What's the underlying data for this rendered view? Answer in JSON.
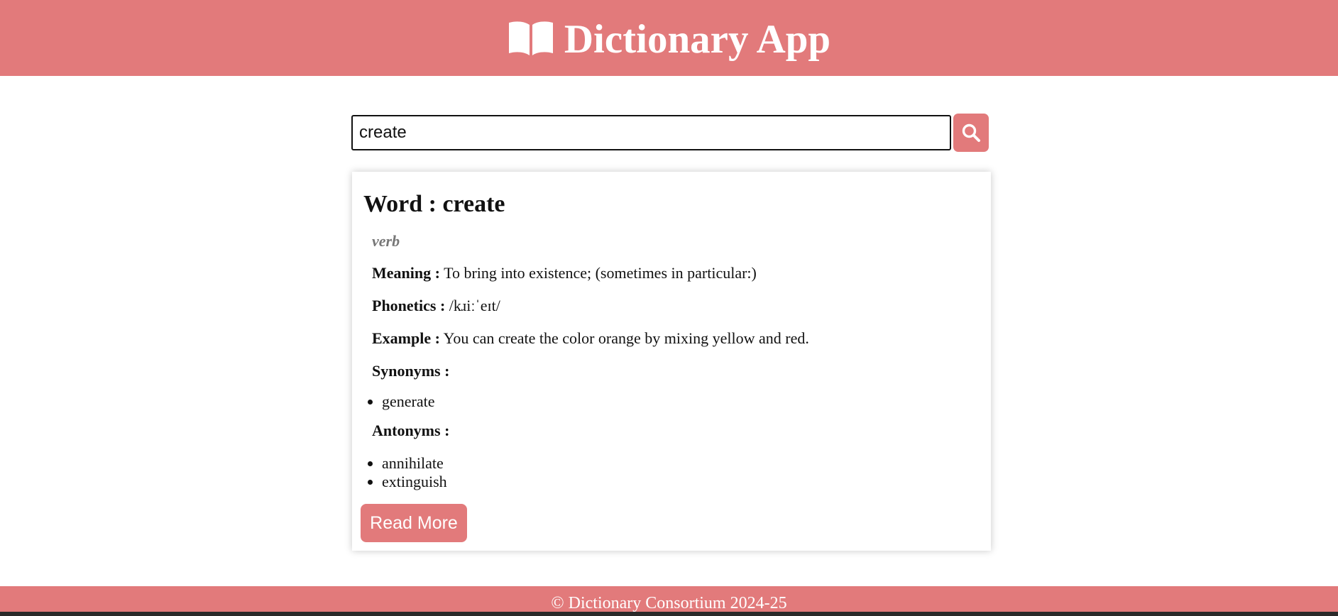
{
  "header": {
    "title": "Dictionary App",
    "icon": "book-icon"
  },
  "search": {
    "value": "create",
    "button_icon": "search-icon"
  },
  "result": {
    "word_label": "Word : create",
    "part_of_speech": "verb",
    "meaning_label": "Meaning :",
    "meaning": "To bring into existence; (sometimes in particular:)",
    "phonetics_label": "Phonetics :",
    "phonetics": "/kɹiːˈeɪt/",
    "example_label": "Example :",
    "example": "You can create the color orange by mixing yellow and red.",
    "synonyms_label": "Synonyms :",
    "synonyms": [
      "generate"
    ],
    "antonyms_label": "Antonyms :",
    "antonyms": [
      "annihilate",
      "extinguish"
    ],
    "read_more_label": "Read More"
  },
  "footer": {
    "text": "© Dictionary Consortium 2024-25"
  },
  "colors": {
    "accent": "#e27a7b",
    "background": "#ffffff",
    "text": "#111111",
    "muted": "#777777"
  }
}
